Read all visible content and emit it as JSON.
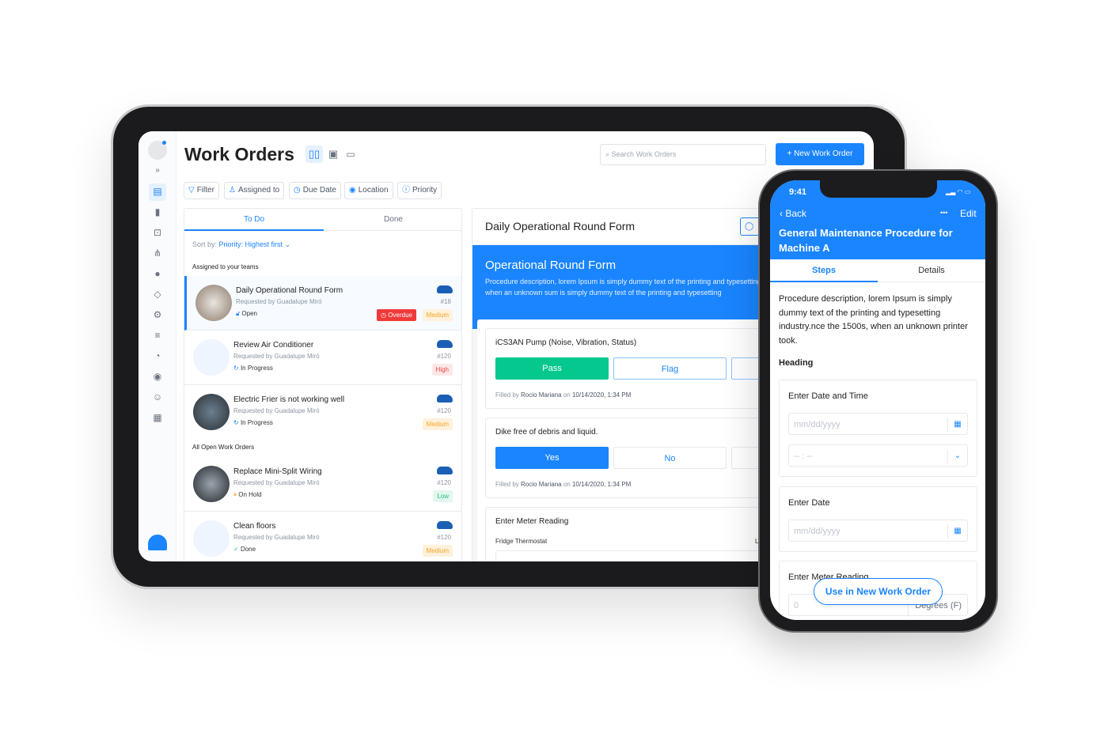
{
  "colors": {
    "accent": "#1a85ff",
    "pass": "#05c88f",
    "overdue": "#f03a3a",
    "medium": "#f5a623",
    "high": "#f04848",
    "low": "#1ec682"
  },
  "tablet": {
    "title": "Work Orders",
    "view_icons": [
      "columns-icon",
      "table-icon",
      "calendar-icon"
    ],
    "search_placeholder": "Search Work Orders",
    "new_button": "New Work Order",
    "filters": [
      "Filter",
      "Assigned to",
      "Due Date",
      "Location",
      "Priority"
    ],
    "tabs": [
      "To Do",
      "Done"
    ],
    "sort_label": "Sort by:",
    "sort_value": "Priority: Highest first",
    "section1": "Assigned to your teams",
    "section2": "All Open Work Orders",
    "orders": [
      {
        "title": "Daily Operational Round Form",
        "requested": "Requested by Guadalupe Miró",
        "status": "Open",
        "number": "#18",
        "overdue": "Overdue",
        "priority": "Medium"
      },
      {
        "title": "Review Air Conditioner",
        "requested": "Requested by Guadalupe Miró",
        "status": "In Progress",
        "number": "#120",
        "priority": "High"
      },
      {
        "title": "Electric Frier is not working well",
        "requested": "Requested by Guadalupe Miró",
        "status": "In Progress",
        "number": "#120",
        "priority": "Medium"
      },
      {
        "title": "Replace Mini-Split Wiring",
        "requested": "Requested by Guadalupe Miró",
        "status": "On Hold",
        "number": "#120",
        "priority": "Low"
      },
      {
        "title": "Clean floors",
        "requested": "Requested by Guadalupe Miró",
        "status": "Done",
        "number": "#120",
        "priority": "Medium"
      }
    ],
    "detail": {
      "title": "Daily Operational Round Form",
      "banner_title": "Operational Round Form",
      "banner_desc": "Procedure description, lorem Ipsum is simply dummy text of the printing and typesetting industry since the 1500s, when an unknown sum is simply dummy text of the printing and typesetting",
      "q1": {
        "label": "iCS3AN Pump (Noise, Vibration, Status)",
        "opt1": "Pass",
        "opt2": "Flag",
        "filled_prefix": "Filled by",
        "filled_by": "Rocio Mariana",
        "filled_on": "on",
        "filled_date": "10/14/2020, 1:34 PM"
      },
      "q2": {
        "label": "Dike free of debris and liquid.",
        "opt1": "Yes",
        "opt2": "No",
        "filled_prefix": "Filled by",
        "filled_by": "Rocio Mariana",
        "filled_on": "on",
        "filled_date": "10/14/2020, 1:34 PM"
      },
      "q3": {
        "label": "Enter Meter Reading",
        "sub": "Fridge Thermostat",
        "sub_right": "La"
      }
    }
  },
  "phone": {
    "time": "9:41",
    "back": "Back",
    "more": "•••",
    "edit": "Edit",
    "title": "General Maintenance Procedure for Machine A",
    "tabs": [
      "Steps",
      "Details"
    ],
    "desc": "Procedure description, lorem Ipsum is simply dummy text of the printing and typesetting industry.nce the 1500s, when an unknown printer took.",
    "heading": "Heading",
    "f1": {
      "label": "Enter Date and Time",
      "date_ph": "mm/dd/yyyy",
      "time_ph": "-- : --"
    },
    "f2": {
      "label": "Enter Date",
      "date_ph": "mm/dd/yyyy"
    },
    "f3": {
      "label": "Enter Meter Reading",
      "value": "0",
      "unit": "Degrees (F)"
    },
    "cta": "Use in New Work Order"
  }
}
